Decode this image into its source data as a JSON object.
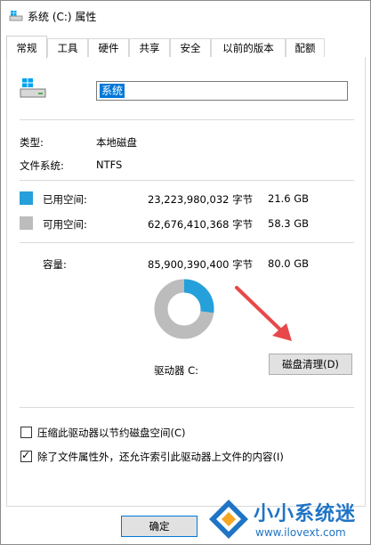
{
  "window": {
    "title": "系统 (C:) 属性"
  },
  "tabs": [
    {
      "label": "常规",
      "active": true
    },
    {
      "label": "工具"
    },
    {
      "label": "硬件"
    },
    {
      "label": "共享"
    },
    {
      "label": "安全"
    },
    {
      "label": "以前的版本"
    },
    {
      "label": "配额"
    }
  ],
  "general": {
    "name_value": "系统",
    "type_label": "类型:",
    "type_value": "本地磁盘",
    "fs_label": "文件系统:",
    "fs_value": "NTFS",
    "used_label": "已用空间:",
    "used_bytes": "23,223,980,032 字节",
    "used_gb": "21.6 GB",
    "free_label": "可用空间:",
    "free_bytes": "62,676,410,368 字节",
    "free_gb": "58.3 GB",
    "capacity_label": "容量:",
    "capacity_bytes": "85,900,390,400 字节",
    "capacity_gb": "80.0 GB",
    "drive_label": "驱动器 C:",
    "cleanup_button": "磁盘清理(D)",
    "compress_label": "压缩此驱动器以节约磁盘空间(C)",
    "compress_checked": false,
    "index_label": "除了文件属性外，还允许索引此驱动器上文件的内容(I)",
    "index_checked": true,
    "used_fraction": 0.27
  },
  "footer": {
    "ok_button": "确定"
  },
  "watermark": {
    "title": "小小系统迷",
    "url": "www.ilovext.com"
  },
  "colors": {
    "used": "#26a0da",
    "free": "#bcbcbc",
    "accent": "#0078d7",
    "arrow": "#e8484a"
  }
}
